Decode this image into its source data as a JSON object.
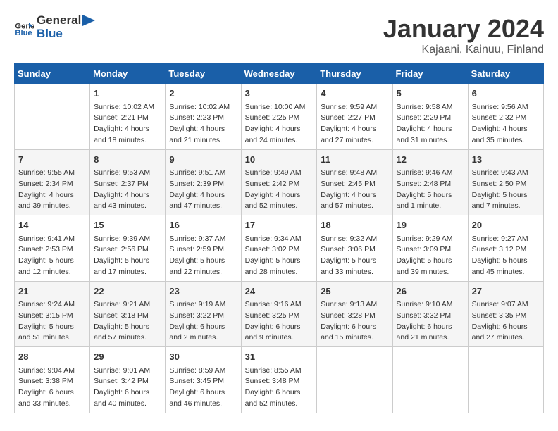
{
  "header": {
    "logo_general": "General",
    "logo_blue": "Blue",
    "title": "January 2024",
    "subtitle": "Kajaani, Kainuu, Finland"
  },
  "weekdays": [
    "Sunday",
    "Monday",
    "Tuesday",
    "Wednesday",
    "Thursday",
    "Friday",
    "Saturday"
  ],
  "weeks": [
    [
      {
        "day": "",
        "info": ""
      },
      {
        "day": "1",
        "info": "Sunrise: 10:02 AM\nSunset: 2:21 PM\nDaylight: 4 hours\nand 18 minutes."
      },
      {
        "day": "2",
        "info": "Sunrise: 10:02 AM\nSunset: 2:23 PM\nDaylight: 4 hours\nand 21 minutes."
      },
      {
        "day": "3",
        "info": "Sunrise: 10:00 AM\nSunset: 2:25 PM\nDaylight: 4 hours\nand 24 minutes."
      },
      {
        "day": "4",
        "info": "Sunrise: 9:59 AM\nSunset: 2:27 PM\nDaylight: 4 hours\nand 27 minutes."
      },
      {
        "day": "5",
        "info": "Sunrise: 9:58 AM\nSunset: 2:29 PM\nDaylight: 4 hours\nand 31 minutes."
      },
      {
        "day": "6",
        "info": "Sunrise: 9:56 AM\nSunset: 2:32 PM\nDaylight: 4 hours\nand 35 minutes."
      }
    ],
    [
      {
        "day": "7",
        "info": "Sunrise: 9:55 AM\nSunset: 2:34 PM\nDaylight: 4 hours\nand 39 minutes."
      },
      {
        "day": "8",
        "info": "Sunrise: 9:53 AM\nSunset: 2:37 PM\nDaylight: 4 hours\nand 43 minutes."
      },
      {
        "day": "9",
        "info": "Sunrise: 9:51 AM\nSunset: 2:39 PM\nDaylight: 4 hours\nand 47 minutes."
      },
      {
        "day": "10",
        "info": "Sunrise: 9:49 AM\nSunset: 2:42 PM\nDaylight: 4 hours\nand 52 minutes."
      },
      {
        "day": "11",
        "info": "Sunrise: 9:48 AM\nSunset: 2:45 PM\nDaylight: 4 hours\nand 57 minutes."
      },
      {
        "day": "12",
        "info": "Sunrise: 9:46 AM\nSunset: 2:48 PM\nDaylight: 5 hours\nand 1 minute."
      },
      {
        "day": "13",
        "info": "Sunrise: 9:43 AM\nSunset: 2:50 PM\nDaylight: 5 hours\nand 7 minutes."
      }
    ],
    [
      {
        "day": "14",
        "info": "Sunrise: 9:41 AM\nSunset: 2:53 PM\nDaylight: 5 hours\nand 12 minutes."
      },
      {
        "day": "15",
        "info": "Sunrise: 9:39 AM\nSunset: 2:56 PM\nDaylight: 5 hours\nand 17 minutes."
      },
      {
        "day": "16",
        "info": "Sunrise: 9:37 AM\nSunset: 2:59 PM\nDaylight: 5 hours\nand 22 minutes."
      },
      {
        "day": "17",
        "info": "Sunrise: 9:34 AM\nSunset: 3:02 PM\nDaylight: 5 hours\nand 28 minutes."
      },
      {
        "day": "18",
        "info": "Sunrise: 9:32 AM\nSunset: 3:06 PM\nDaylight: 5 hours\nand 33 minutes."
      },
      {
        "day": "19",
        "info": "Sunrise: 9:29 AM\nSunset: 3:09 PM\nDaylight: 5 hours\nand 39 minutes."
      },
      {
        "day": "20",
        "info": "Sunrise: 9:27 AM\nSunset: 3:12 PM\nDaylight: 5 hours\nand 45 minutes."
      }
    ],
    [
      {
        "day": "21",
        "info": "Sunrise: 9:24 AM\nSunset: 3:15 PM\nDaylight: 5 hours\nand 51 minutes."
      },
      {
        "day": "22",
        "info": "Sunrise: 9:21 AM\nSunset: 3:18 PM\nDaylight: 5 hours\nand 57 minutes."
      },
      {
        "day": "23",
        "info": "Sunrise: 9:19 AM\nSunset: 3:22 PM\nDaylight: 6 hours\nand 2 minutes."
      },
      {
        "day": "24",
        "info": "Sunrise: 9:16 AM\nSunset: 3:25 PM\nDaylight: 6 hours\nand 9 minutes."
      },
      {
        "day": "25",
        "info": "Sunrise: 9:13 AM\nSunset: 3:28 PM\nDaylight: 6 hours\nand 15 minutes."
      },
      {
        "day": "26",
        "info": "Sunrise: 9:10 AM\nSunset: 3:32 PM\nDaylight: 6 hours\nand 21 minutes."
      },
      {
        "day": "27",
        "info": "Sunrise: 9:07 AM\nSunset: 3:35 PM\nDaylight: 6 hours\nand 27 minutes."
      }
    ],
    [
      {
        "day": "28",
        "info": "Sunrise: 9:04 AM\nSunset: 3:38 PM\nDaylight: 6 hours\nand 33 minutes."
      },
      {
        "day": "29",
        "info": "Sunrise: 9:01 AM\nSunset: 3:42 PM\nDaylight: 6 hours\nand 40 minutes."
      },
      {
        "day": "30",
        "info": "Sunrise: 8:59 AM\nSunset: 3:45 PM\nDaylight: 6 hours\nand 46 minutes."
      },
      {
        "day": "31",
        "info": "Sunrise: 8:55 AM\nSunset: 3:48 PM\nDaylight: 6 hours\nand 52 minutes."
      },
      {
        "day": "",
        "info": ""
      },
      {
        "day": "",
        "info": ""
      },
      {
        "day": "",
        "info": ""
      }
    ]
  ]
}
